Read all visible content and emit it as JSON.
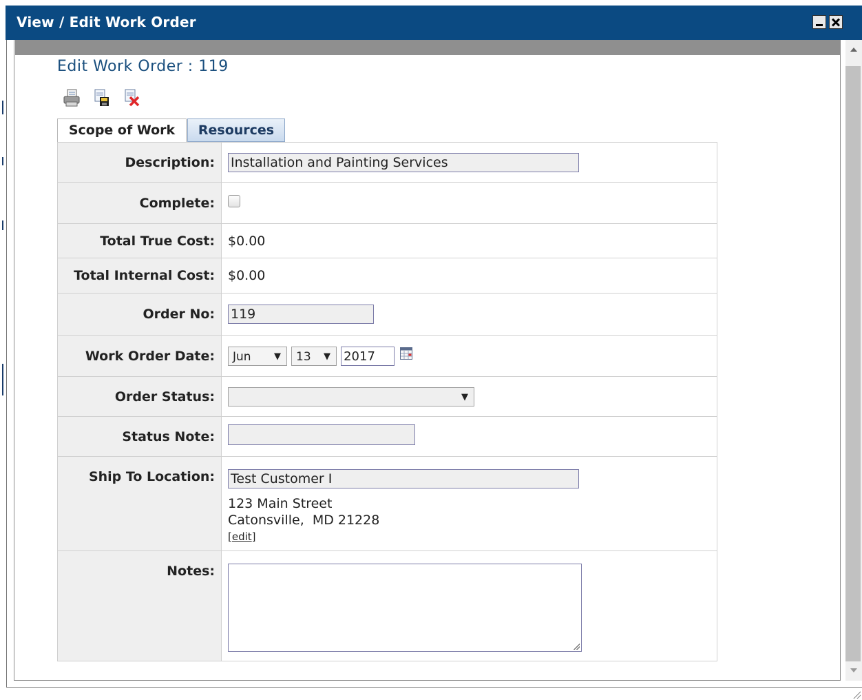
{
  "window": {
    "title": "View / Edit Work Order",
    "minimize_label": "minimize",
    "close_label": "close"
  },
  "page": {
    "heading": "Edit Work Order : 119"
  },
  "toolbar": {
    "icons": [
      "print-icon",
      "save-icon",
      "cancel-icon"
    ]
  },
  "tabs": [
    {
      "label": "Scope of Work",
      "active": true
    },
    {
      "label": "Resources",
      "active": false
    }
  ],
  "form": {
    "description": {
      "label": "Description:",
      "value": "Installation and Painting Services"
    },
    "complete": {
      "label": "Complete:",
      "checked": false
    },
    "total_true_cost": {
      "label": "Total True Cost:",
      "value": "$0.00"
    },
    "total_internal_cost": {
      "label": "Total Internal Cost:",
      "value": "$0.00"
    },
    "order_no": {
      "label": "Order No:",
      "value": "119"
    },
    "work_order_date": {
      "label": "Work Order Date:",
      "month": "Jun",
      "day": "13",
      "year": "2017"
    },
    "order_status": {
      "label": "Order Status:",
      "value": ""
    },
    "status_note": {
      "label": "Status Note:",
      "value": ""
    },
    "ship_to": {
      "label": "Ship To Location:",
      "value": "Test Customer I",
      "address_line1": "123 Main Street",
      "address_line2": "Catonsville,  MD 21228",
      "edit_open": "[",
      "edit_label": "edit",
      "edit_close": "]"
    },
    "notes": {
      "label": "Notes:",
      "value": ""
    }
  },
  "colors": {
    "titlebar": "#0b4a82",
    "heading": "#1a4f7e",
    "label_bg": "#efefef"
  }
}
